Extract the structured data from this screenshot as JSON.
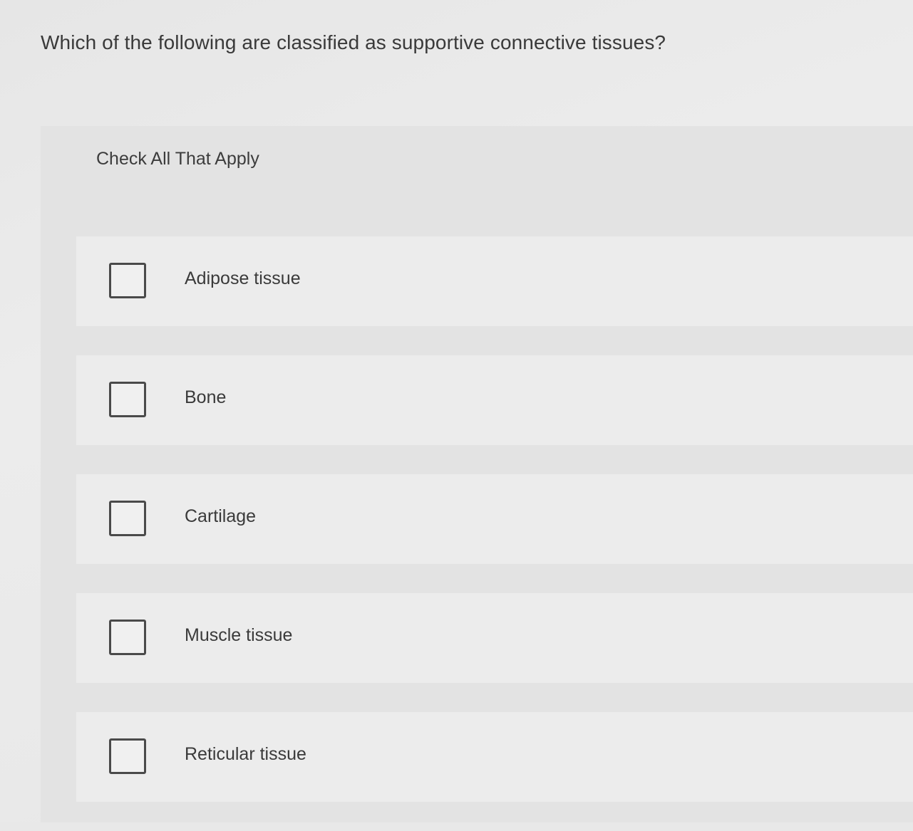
{
  "question": {
    "text": "Which of the following are classified as supportive connective tissues?"
  },
  "instruction": "Check All That Apply",
  "options": [
    {
      "label": "Adipose tissue",
      "checked": false
    },
    {
      "label": "Bone",
      "checked": false
    },
    {
      "label": "Cartilage",
      "checked": false
    },
    {
      "label": "Muscle tissue",
      "checked": false
    },
    {
      "label": "Reticular tissue",
      "checked": false
    }
  ],
  "colors": {
    "background": "#e8e8e8",
    "panel": "#e3e3e3",
    "row": "#ececec",
    "text": "#3a3a3a",
    "checkbox_border": "#4a4a4a"
  }
}
